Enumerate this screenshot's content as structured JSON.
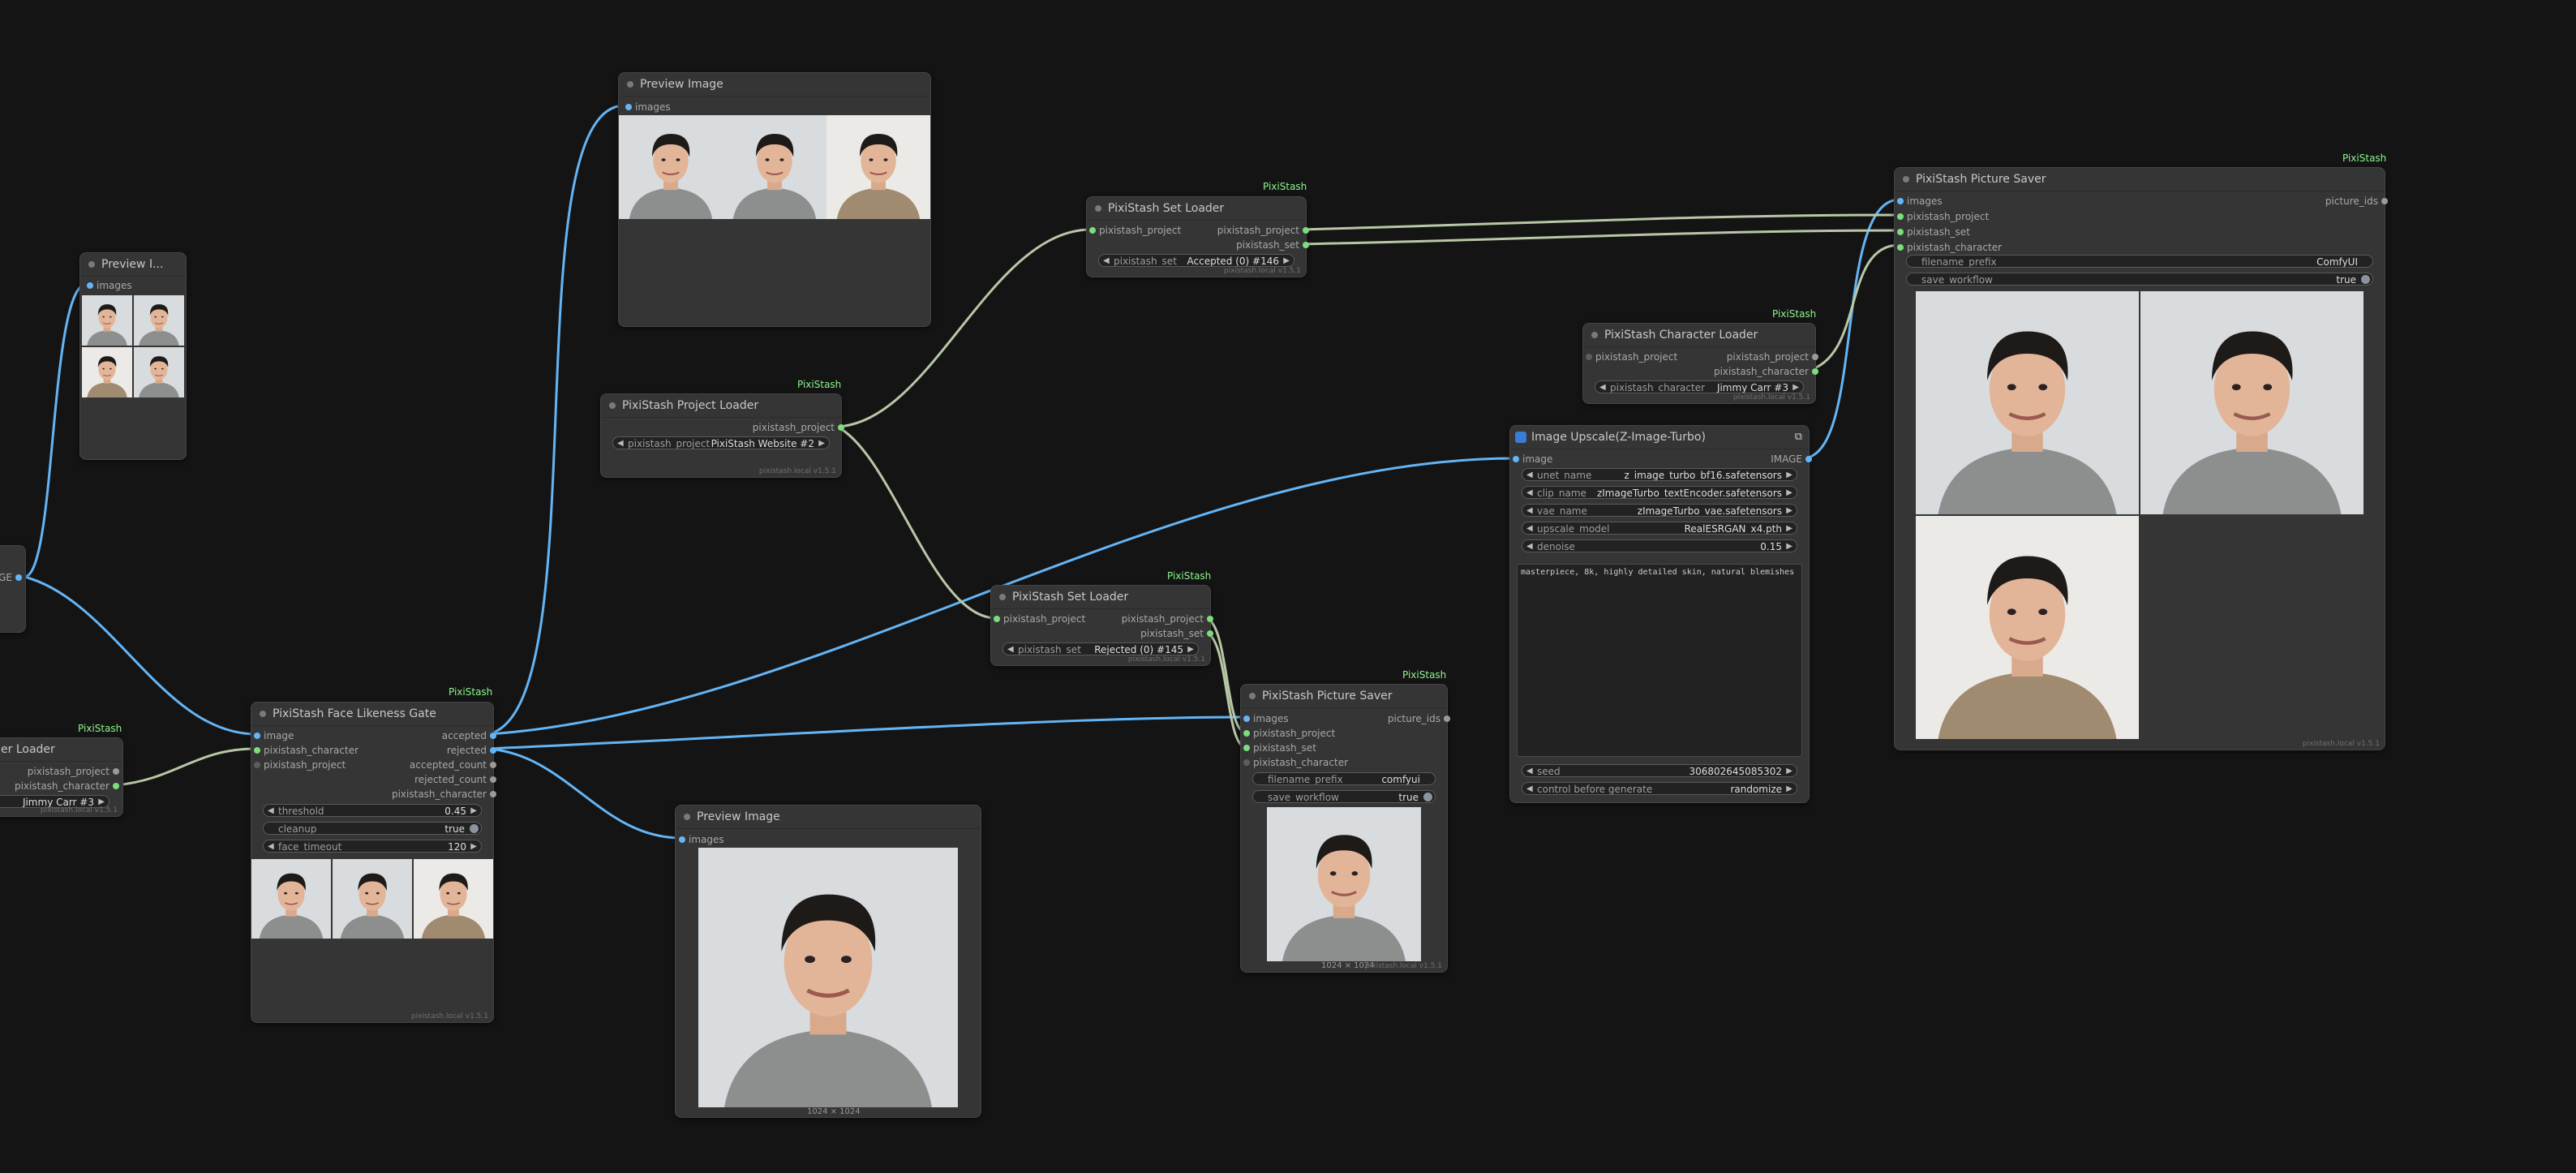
{
  "badges": {
    "pixistash": "PixiStash"
  },
  "footer_version": "pixistash.local v1.5.1",
  "nodes": {
    "preview_small": {
      "title": "Preview I...",
      "inputs": [
        "images"
      ]
    },
    "partial_loader": {
      "title": "er Loader",
      "outputs": [
        "pixistash_project",
        "pixistash_character"
      ],
      "widgets": [
        {
          "value": "Jimmy Carr #3"
        }
      ]
    },
    "partial_image_out": {
      "label": "GE"
    },
    "preview_top": {
      "title": "Preview Image",
      "inputs": [
        "images"
      ]
    },
    "project_loader": {
      "title": "PixiStash Project Loader",
      "outputs": [
        "pixistash_project"
      ],
      "widgets": [
        {
          "label": "pixistash_project",
          "value": "PixiStash Website #2"
        }
      ]
    },
    "face_gate": {
      "title": "PixiStash Face Likeness Gate",
      "inputs": [
        "image",
        "pixistash_character",
        "pixistash_project"
      ],
      "outputs": [
        "accepted",
        "rejected",
        "accepted_count",
        "rejected_count",
        "pixistash_character"
      ],
      "widgets": [
        {
          "label": "threshold",
          "value": "0.45"
        },
        {
          "label": "cleanup",
          "value": "true"
        },
        {
          "label": "face_timeout",
          "value": "120"
        }
      ]
    },
    "preview_bottom": {
      "title": "Preview Image",
      "inputs": [
        "images"
      ],
      "caption": "1024 × 1024"
    },
    "set_loader_top": {
      "title": "PixiStash Set Loader",
      "inputs": [
        "pixistash_project"
      ],
      "outputs": [
        "pixistash_project",
        "pixistash_set"
      ],
      "widgets": [
        {
          "label": "pixistash_set",
          "value": "Accepted (0) #146"
        }
      ]
    },
    "set_loader_mid": {
      "title": "PixiStash Set Loader",
      "inputs": [
        "pixistash_project"
      ],
      "outputs": [
        "pixistash_project",
        "pixistash_set"
      ],
      "widgets": [
        {
          "label": "pixistash_set",
          "value": "Rejected (0) #145"
        }
      ]
    },
    "saver_small": {
      "title": "PixiStash Picture Saver",
      "inputs": [
        "images",
        "pixistash_project",
        "pixistash_set",
        "pixistash_character"
      ],
      "outputs": [
        "picture_ids"
      ],
      "widgets": [
        {
          "label": "filename_prefix",
          "value": "comfyui"
        },
        {
          "label": "save_workflow",
          "value": "true"
        }
      ],
      "caption": "1024 × 1024"
    },
    "char_loader": {
      "title": "PixiStash Character Loader",
      "inputs": [
        "pixistash_project"
      ],
      "outputs": [
        "pixistash_project",
        "pixistash_set",
        "pixistash_character"
      ],
      "widgets": [
        {
          "label": "pixistash_character",
          "value": "Jimmy Carr #3"
        }
      ]
    },
    "upscale": {
      "title": "Image Upscale(Z-Image-Turbo)",
      "inputs": [
        "image"
      ],
      "outputs": [
        "IMAGE"
      ],
      "widgets": [
        {
          "label": "unet_name",
          "value": "z_image_turbo_bf16.safetensors"
        },
        {
          "label": "clip_name",
          "value": "zImageTurbo_textEncoder.safetensors"
        },
        {
          "label": "vae_name",
          "value": "zImageTurbo_vae.safetensors"
        },
        {
          "label": "upscale_model",
          "value": "RealESRGAN_x4.pth"
        },
        {
          "label": "denoise",
          "value": "0.15"
        }
      ],
      "prompt": "masterpiece, 8k, highly detailed skin, natural blemishes",
      "bottom_widgets": [
        {
          "label": "seed",
          "value": "306802645085302"
        },
        {
          "label": "control before generate",
          "value": "randomize"
        }
      ]
    },
    "saver_big": {
      "title": "PixiStash Picture Saver",
      "inputs": [
        "images",
        "pixistash_project",
        "pixistash_set",
        "pixistash_character"
      ],
      "outputs": [
        "picture_ids"
      ],
      "widgets": [
        {
          "label": "filename_prefix",
          "value": "ComfyUI"
        },
        {
          "label": "save_workflow",
          "value": "true"
        }
      ]
    }
  },
  "colors": {
    "image_link": "#64b5f6",
    "data_link": "#b8c7a6",
    "badge": "#8ef58e"
  }
}
